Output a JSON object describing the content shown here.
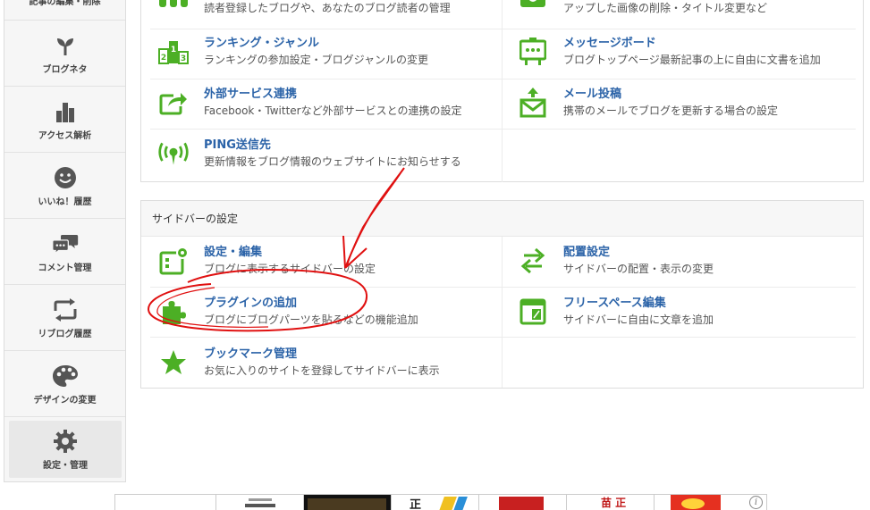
{
  "sidebar": {
    "top_cut_label": "記事の編集・削除",
    "items": [
      {
        "label": "ブログネタ",
        "icon": "sprout-icon"
      },
      {
        "label": "アクセス解析",
        "icon": "bar-chart-icon"
      },
      {
        "label": "いいね！履歴",
        "icon": "smiley-icon"
      },
      {
        "label": "コメント管理",
        "icon": "chat-bubbles-icon"
      },
      {
        "label": "リブログ履歴",
        "icon": "reblog-icon"
      },
      {
        "label": "デザインの変更",
        "icon": "palette-icon"
      },
      {
        "label": "設定・管理",
        "icon": "gear-icon"
      }
    ]
  },
  "top_panel": {
    "items": [
      {
        "title": "",
        "desc": "読者登録したブログや、あなたのブログ読者の管理",
        "icon": "readers-icon"
      },
      {
        "title": "",
        "desc": "アップした画像の削除・タイトル変更など",
        "icon": "camera-icon"
      },
      {
        "title": "ランキング・ジャンル",
        "desc": "ランキングの参加設定・ブログジャンルの変更",
        "icon": "podium-icon"
      },
      {
        "title": "メッセージボード",
        "desc": "ブログトップページ最新記事の上に自由に文書を追加",
        "icon": "message-board-icon"
      },
      {
        "title": "外部サービス連携",
        "desc": "Facebook・Twitterなど外部サービスとの連携の設定",
        "icon": "share-icon"
      },
      {
        "title": "メール投稿",
        "desc": "携帯のメールでブログを更新する場合の設定",
        "icon": "mail-upload-icon"
      },
      {
        "title": "PING送信先",
        "desc": "更新情報をブログ情報のウェブサイトにお知らせする",
        "icon": "broadcast-icon"
      }
    ]
  },
  "sidebar_panel": {
    "heading": "サイドバーの設定",
    "items": [
      {
        "title": "設定・編集",
        "desc": "ブログに表示するサイドバーの設定",
        "icon": "sidebar-settings-icon"
      },
      {
        "title": "配置設定",
        "desc": "サイドバーの配置・表示の変更",
        "icon": "swap-arrows-icon"
      },
      {
        "title": "プラグインの追加",
        "desc": "ブログにブログパーツを貼るなどの機能追加",
        "icon": "puzzle-icon"
      },
      {
        "title": "フリースペース編集",
        "desc": "サイドバーに自由に文章を追加",
        "icon": "free-space-icon"
      },
      {
        "title": "ブックマーク管理",
        "desc": "お気に入りのサイトを登録してサイドバーに表示",
        "icon": "star-icon"
      }
    ]
  },
  "ads": {
    "info_glyph": "i",
    "thumb_texts": [
      "",
      "",
      "",
      "正",
      "",
      "苗 正",
      ""
    ]
  },
  "colors": {
    "icon_green": "#4caf25",
    "title_blue": "#2b63a8",
    "annotation_red": "#e01010"
  }
}
